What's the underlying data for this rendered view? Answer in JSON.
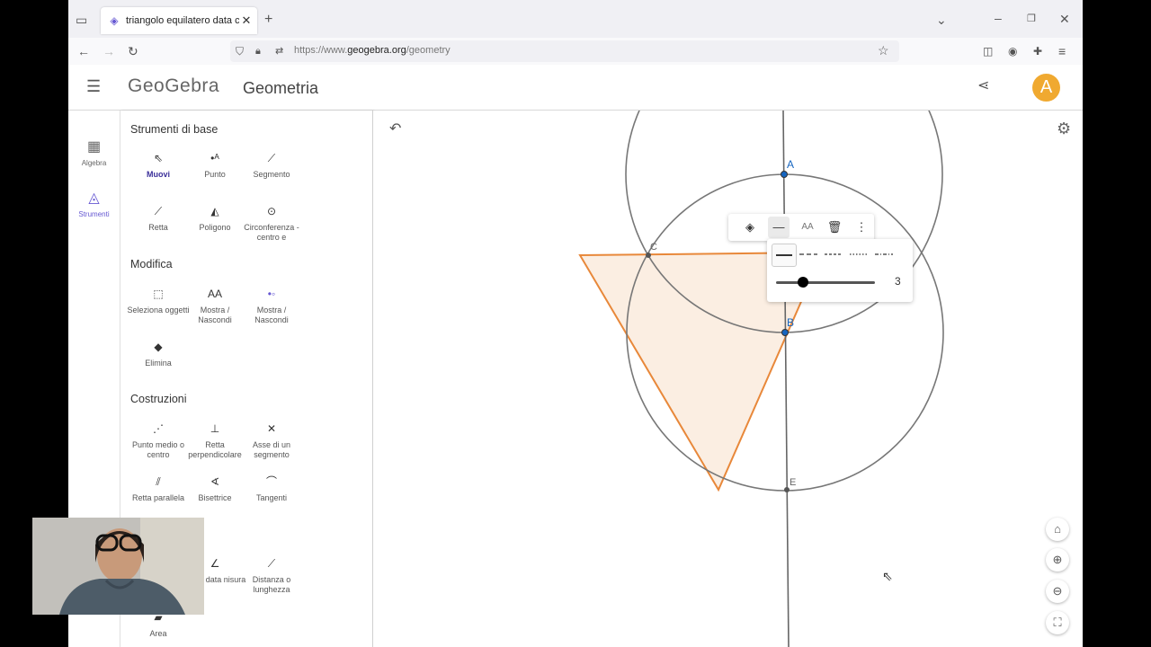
{
  "browser": {
    "tab_title": "triangolo equilatero data circ c",
    "url_prefix": "https://www.",
    "url_host": "geogebra.org",
    "url_path": "/geometry"
  },
  "app": {
    "logo": "GeoGebra",
    "title": "Geometria",
    "avatar_letter": "A",
    "accent_color": "#6557d2",
    "avatar_color": "#f0a930"
  },
  "rail": [
    {
      "label": "Algebra",
      "icon": "calculator-icon"
    },
    {
      "label": "Strumenti",
      "icon": "tools-icon"
    }
  ],
  "tools": {
    "sections": [
      "Strumenti di base",
      "Modifica",
      "Costruzioni"
    ],
    "basic": [
      {
        "label": "Muovi",
        "icon": "pointer-icon"
      },
      {
        "label": "Punto",
        "icon": "point-icon"
      },
      {
        "label": "Segmento",
        "icon": "segment-icon"
      },
      {
        "label": "Retta",
        "icon": "line-icon"
      },
      {
        "label": "Poligono",
        "icon": "polygon-icon"
      },
      {
        "label": "Circonferenza - centro e",
        "icon": "circle-icon"
      }
    ],
    "edit": [
      {
        "label": "Seleziona oggetti",
        "icon": "select-icon"
      },
      {
        "label": "Mostra / Nascondi",
        "icon": "show-label-icon"
      },
      {
        "label": "Mostra / Nascondi",
        "icon": "show-object-icon"
      },
      {
        "label": "Elimina",
        "icon": "eraser-icon"
      }
    ],
    "constructions": [
      {
        "label": "Punto medio o centro",
        "icon": "midpoint-icon"
      },
      {
        "label": "Retta perpendicolare",
        "icon": "perpendicular-icon"
      },
      {
        "label": "Asse di un segmento",
        "icon": "bisector-icon"
      },
      {
        "label": "Retta parallela",
        "icon": "parallel-icon"
      },
      {
        "label": "Bisettrice",
        "icon": "angle-bisector-icon"
      },
      {
        "label": "Tangenti",
        "icon": "tangent-icon"
      }
    ],
    "measure": [
      {
        "label": "olo di data nisura",
        "icon": "angle-icon"
      },
      {
        "label": "Distanza o lunghezza",
        "icon": "distance-icon"
      },
      {
        "label": "Area",
        "icon": "area-icon"
      }
    ]
  },
  "graphics": {
    "points": [
      "A",
      "B",
      "C",
      "E"
    ],
    "line_thickness": "3",
    "polygon_color": "#e8883a",
    "polygon_fill": "#fbeee2"
  }
}
